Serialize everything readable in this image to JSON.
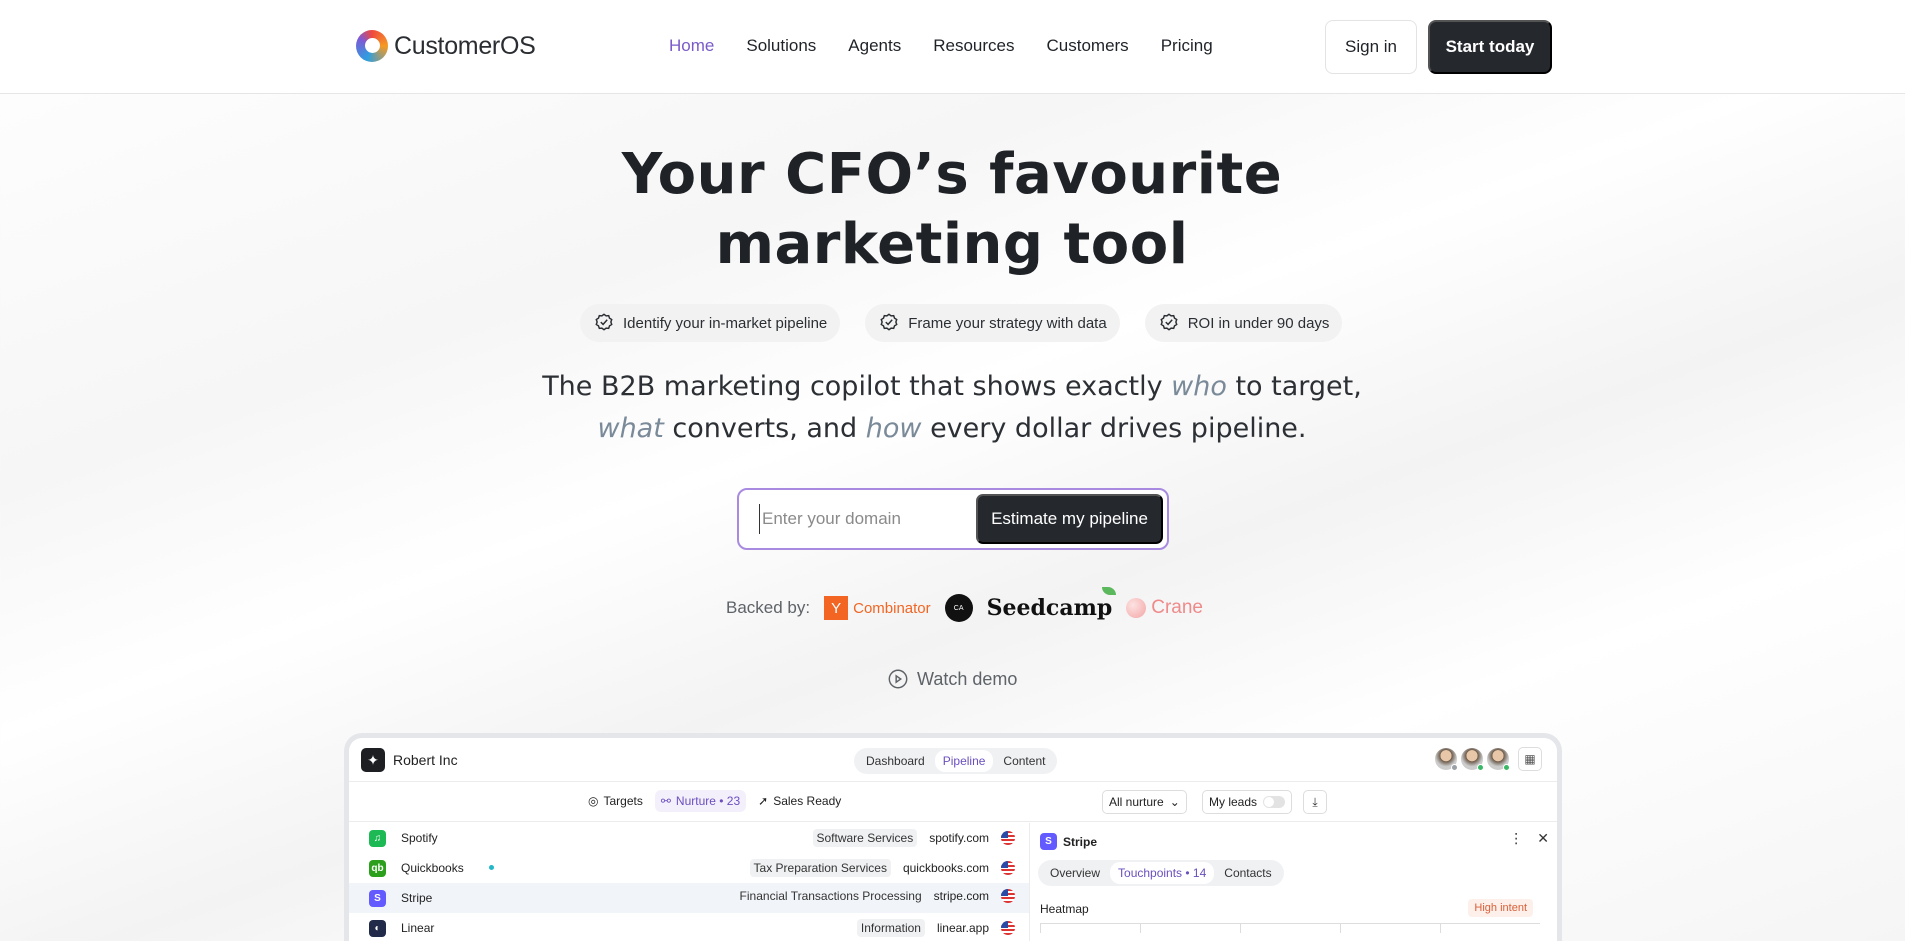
{
  "brand": {
    "name": "CustomerOS"
  },
  "nav": {
    "links": [
      "Home",
      "Solutions",
      "Agents",
      "Resources",
      "Customers",
      "Pricing"
    ],
    "active": "Home",
    "signin": "Sign in",
    "start": "Start today"
  },
  "hero": {
    "title_line1": "Your CFO’s favourite",
    "title_line2": "marketing tool",
    "pills": [
      "Identify your in-market pipeline",
      "Frame your strategy with data",
      "ROI in under 90 days"
    ],
    "sub": {
      "p1": "The B2B marketing copilot that shows exactly ",
      "who": "who",
      "p2": " to target,",
      "what": "what",
      "p3": " converts, and ",
      "how": "how",
      "p4": " every dollar drives pipeline."
    },
    "domain_placeholder": "Enter your domain",
    "estimate": "Estimate my pipeline",
    "backed_label": "Backed by:",
    "backers": {
      "yc_letter": "Y",
      "yc_text": "Combinator",
      "ca": "CA",
      "seedcamp": "Seedcamp",
      "crane": "Crane"
    },
    "watch_demo": "Watch demo"
  },
  "app": {
    "org": "Robert Inc",
    "view_tabs": [
      "Dashboard",
      "Pipeline",
      "Content"
    ],
    "active_view": "Pipeline",
    "stages": [
      "Targets",
      "Nurture • 23",
      "Sales Ready"
    ],
    "active_stage": "Nurture • 23",
    "filter": "All nurture",
    "my_leads": "My leads",
    "rows": [
      {
        "name": "Spotify",
        "industry": "Software Services",
        "domain": "spotify.com",
        "logo": "♫",
        "color": "#1db954",
        "tag": true
      },
      {
        "name": "Quickbooks",
        "industry": "Tax Preparation Services",
        "domain": "quickbooks.com",
        "logo": "qb",
        "color": "#2ca01c",
        "tag": true
      },
      {
        "name": "Stripe",
        "industry": "Financial Transactions Processing",
        "domain": "stripe.com",
        "logo": "S",
        "color": "#635bff",
        "tag": false
      },
      {
        "name": "Linear",
        "industry": "Information",
        "domain": "linear.app",
        "logo": "◐",
        "color": "#222a4a",
        "tag": true
      }
    ],
    "detail": {
      "name": "Stripe",
      "tabs": [
        "Overview",
        "Touchpoints • 14",
        "Contacts"
      ],
      "active_tab": "Touchpoints • 14",
      "heatmap": "Heatmap",
      "intent": "High intent"
    }
  }
}
